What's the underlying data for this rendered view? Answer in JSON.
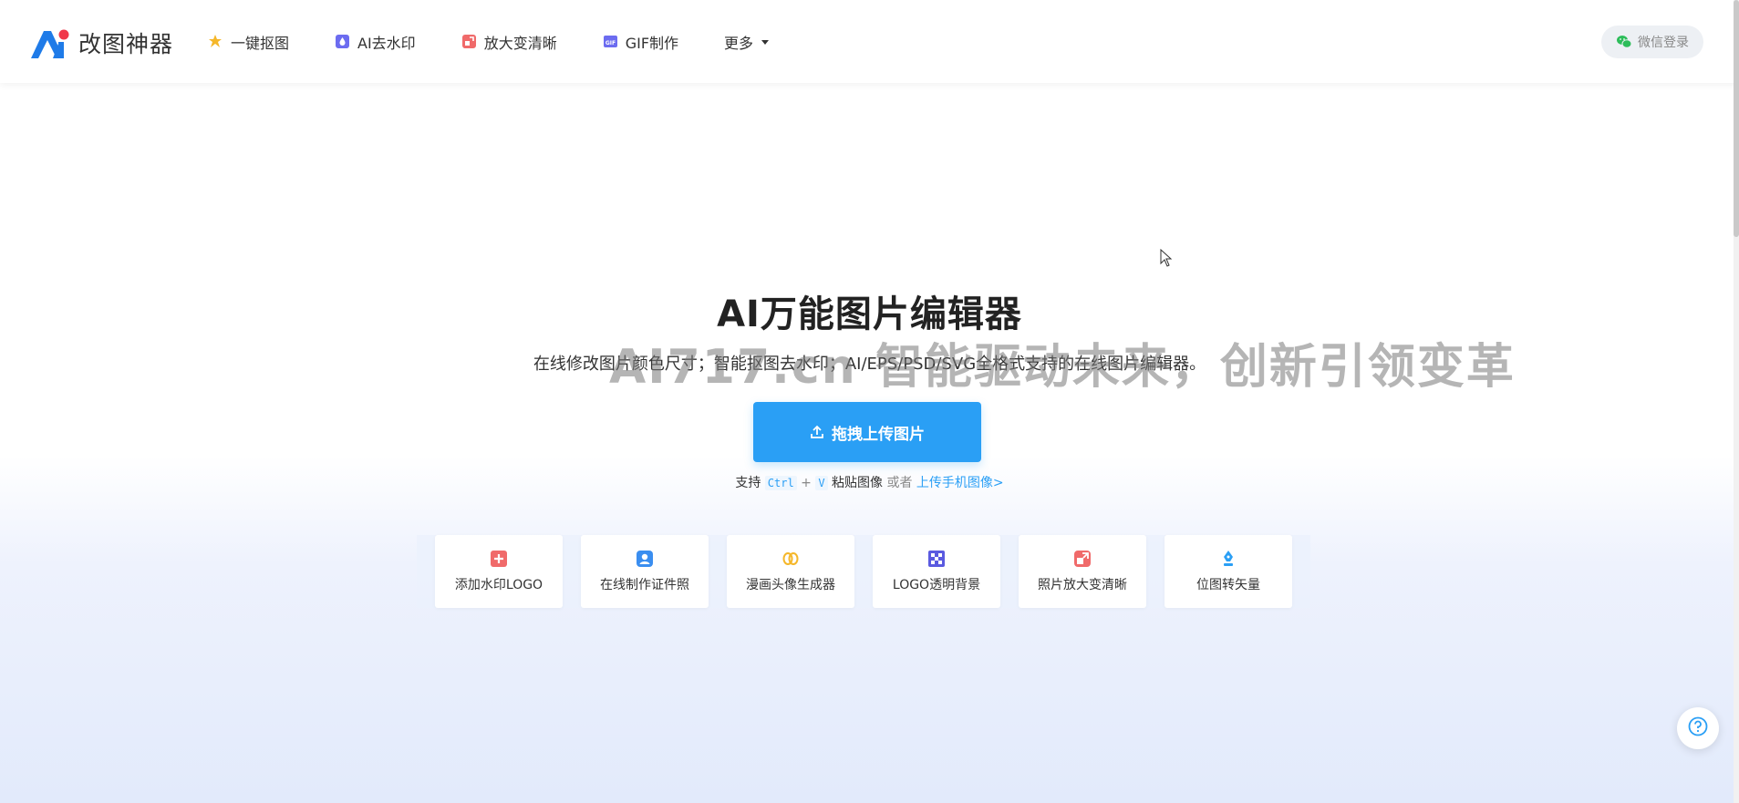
{
  "brand": {
    "name": "改图神器",
    "accent": "#2a9ff5"
  },
  "nav": {
    "items": [
      {
        "label": "一键抠图",
        "icon": "magic-star-icon"
      },
      {
        "label": "AI去水印",
        "icon": "droplet-icon"
      },
      {
        "label": "放大变清晰",
        "icon": "enlarge-icon"
      },
      {
        "label": "GIF制作",
        "icon": "gif-icon"
      },
      {
        "label": "更多",
        "icon": "caret-down-icon"
      }
    ],
    "login_label": "微信登录"
  },
  "hero": {
    "title": "AI万能图片编辑器",
    "subtitle": "在线修改图片颜色尺寸；智能抠图去水印；AI/EPS/PSD/SVG全格式支持的在线图片编辑器。",
    "watermark": "AI717.cn 智能驱动未来，创新引领变革",
    "upload_label": "拖拽上传图片",
    "paste_prefix": "支持",
    "paste_key1": "Ctrl",
    "paste_plus": "+",
    "paste_key2": "V",
    "paste_suffix": "粘贴图像",
    "paste_or": "或者",
    "paste_link": "上传手机图像>"
  },
  "tools": [
    {
      "label": "添加水印LOGO",
      "icon": "plus-square-icon",
      "color": "#f06a6a"
    },
    {
      "label": "在线制作证件照",
      "icon": "id-photo-icon",
      "color": "#3a8ef0"
    },
    {
      "label": "漫画头像生成器",
      "icon": "cartoon-face-icon",
      "color": "#f5b72a"
    },
    {
      "label": "LOGO透明背景",
      "icon": "checkerboard-icon",
      "color": "#5a5ae0"
    },
    {
      "label": "照片放大变清晰",
      "icon": "enlarge-photo-icon",
      "color": "#f06a6a"
    },
    {
      "label": "位图转矢量",
      "icon": "pen-nib-icon",
      "color": "#2a9ff5"
    }
  ]
}
